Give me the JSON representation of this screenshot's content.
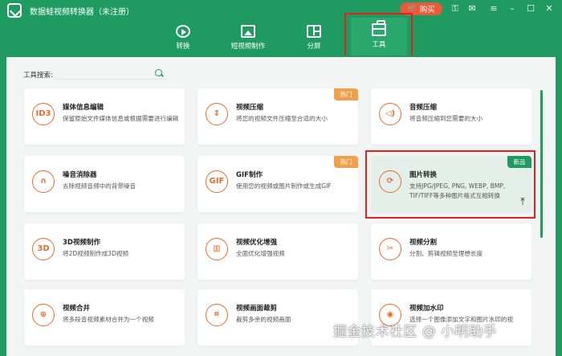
{
  "app": {
    "title": "数据蛙视频转换器（未注册）",
    "buy_label": "购买"
  },
  "colors": {
    "brand": "#1f9a60",
    "accent": "#e86a2c",
    "hot": "#f0a04b",
    "highlight": "#e3201c"
  },
  "nav": {
    "tabs": [
      {
        "label": "转换",
        "icon": "convert-icon"
      },
      {
        "label": "短视频制作",
        "icon": "short-video-icon"
      },
      {
        "label": "分屏",
        "icon": "split-screen-icon"
      },
      {
        "label": "工具",
        "icon": "toolbox-icon",
        "active": true
      }
    ]
  },
  "search": {
    "label": "工具搜索:",
    "value": ""
  },
  "tools": [
    {
      "title": "媒体信息编辑",
      "desc": "保留原始文件媒体信息或根据需要进行编辑",
      "icon_text": "ID3"
    },
    {
      "title": "视频压缩",
      "desc": "将您的视频文件压缩至合适的大小",
      "icon_text": "⇕",
      "badge": "热门"
    },
    {
      "title": "音频压缩",
      "desc": "将音频压缩到您需要的大小",
      "icon_text": "◁)"
    },
    {
      "title": "噪音消除器",
      "desc": "去除视频音频中的背景噪音",
      "icon_text": "∩"
    },
    {
      "title": "GIF制作",
      "desc": "使用您的视频或图片制作或生成GIF",
      "icon_text": "GIF",
      "badge": "热门"
    },
    {
      "title": "图片转换",
      "desc": "支持JPG/JPEG, PNG, WEBP, BMP, TIF/TIFF等多种图片格式互相转换",
      "icon_text": "⟳",
      "badge": "新品",
      "selected": true
    },
    {
      "title": "3D视频制作",
      "desc": "将2D视频制作成3D视频",
      "icon_text": "3D"
    },
    {
      "title": "视频优化增强",
      "desc": "全面优化增强视频",
      "icon_text": "▥"
    },
    {
      "title": "视频分割",
      "desc": "分割、剪辑视频至理想长度",
      "icon_text": "✂"
    },
    {
      "title": "视频合并",
      "desc": "将多段音视频素材合并为一个视频",
      "icon_text": "⊕"
    },
    {
      "title": "视频画面裁剪",
      "desc": "裁剪多余的视频画面",
      "icon_text": "⌗"
    },
    {
      "title": "视频加水印",
      "desc": "选择一个图像添加文字和图片水印的视",
      "icon_text": "◉"
    }
  ],
  "watermark": "掘金技术社区 @ 小明助手"
}
